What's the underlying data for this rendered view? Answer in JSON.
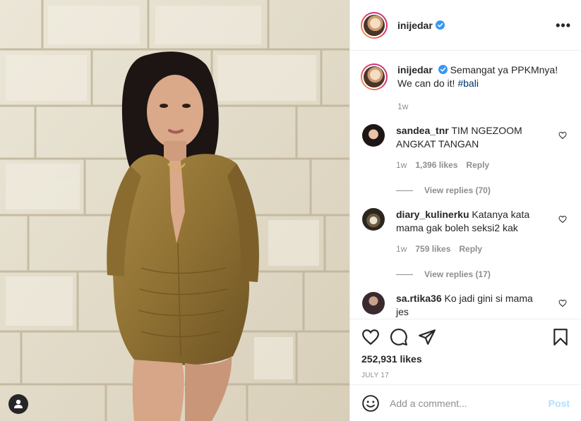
{
  "post": {
    "author": "inijedar",
    "verified": true,
    "more_label": "•••"
  },
  "caption": {
    "username": "inijedar",
    "text": "Semangat ya PPKMnya! We can do it!",
    "hashtag": "#bali",
    "time": "1w"
  },
  "comments": [
    {
      "username": "sandea_tnr",
      "text": "TIM NGEZOOM ANGKAT TANGAN",
      "time": "1w",
      "likes": "1,396 likes",
      "reply_label": "Reply",
      "view_replies": "View replies (70)"
    },
    {
      "username": "diary_kulinerku",
      "text": "Katanya kata mama gak boleh seksi2 kak",
      "time": "1w",
      "likes": "759 likes",
      "reply_label": "Reply",
      "view_replies": "View replies (17)"
    },
    {
      "username": "sa.rtika36",
      "text": "Ko jadi gini si mama jes"
    }
  ],
  "actions": {
    "likes": "252,931 likes",
    "date": "JULY 17"
  },
  "add_comment": {
    "placeholder": "Add a comment...",
    "post_label": "Post"
  },
  "colors": {
    "accent_link": "#00376b",
    "verified": "#3897f0",
    "post_button_disabled": "#b2dffc",
    "secondary_text": "#8e8e8e"
  }
}
